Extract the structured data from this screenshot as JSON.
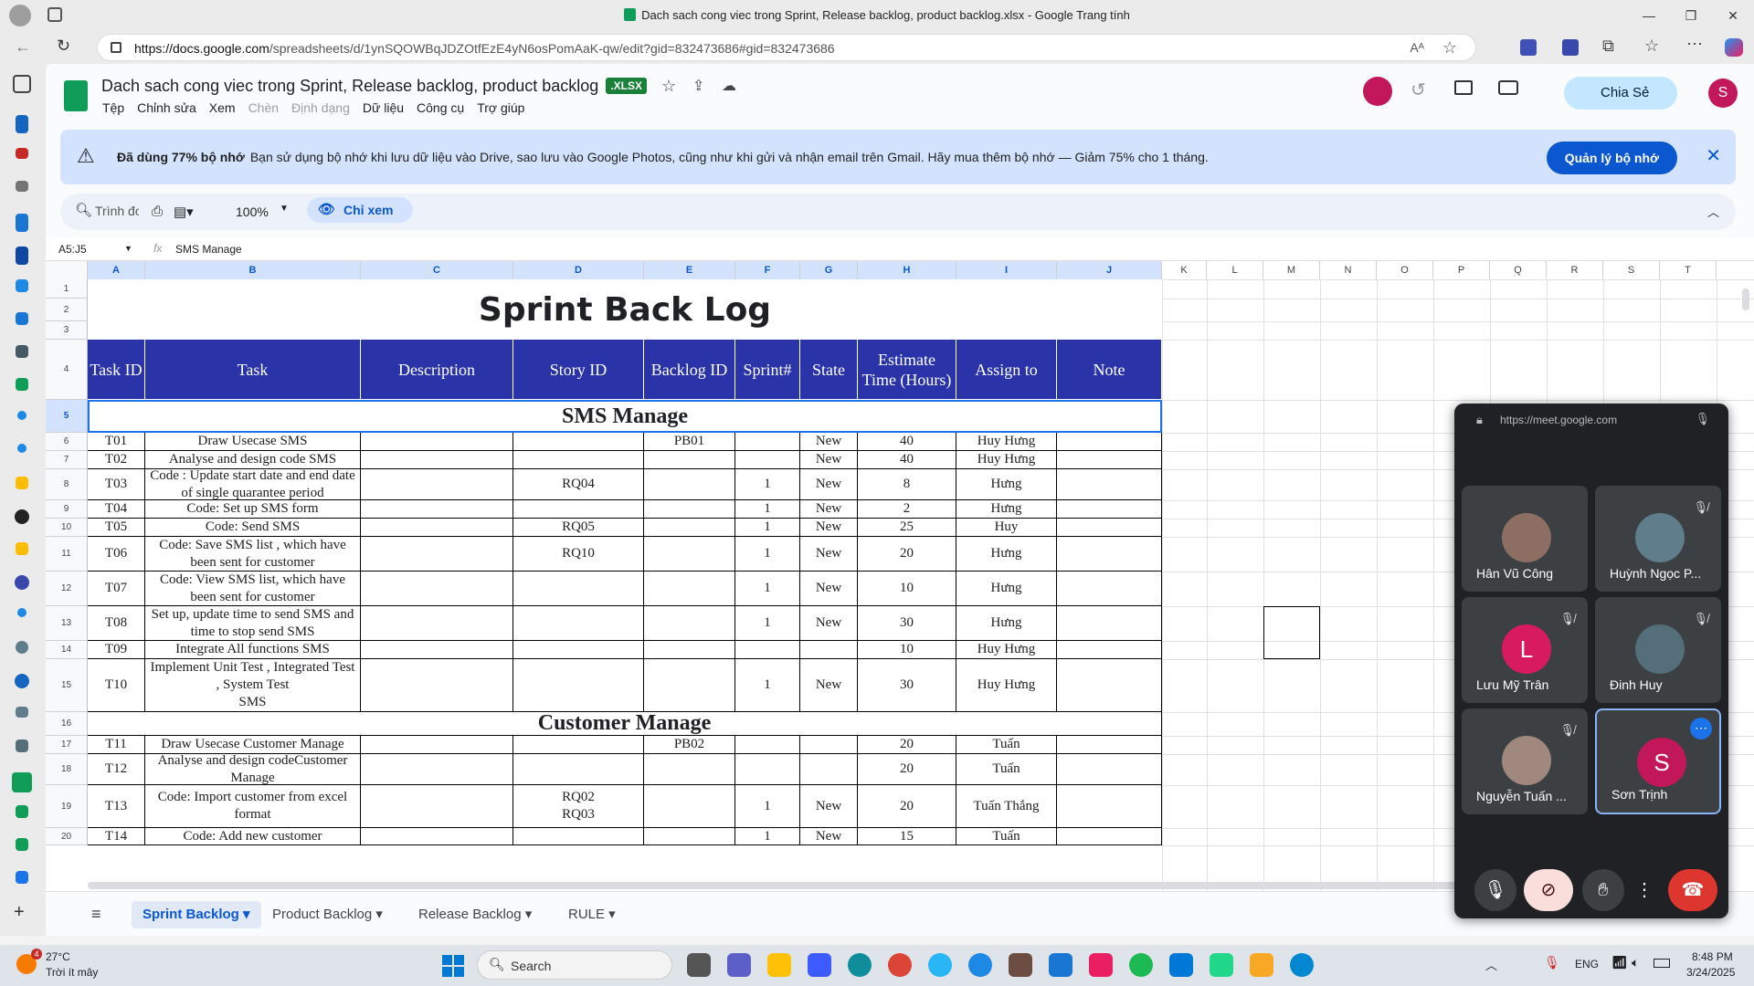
{
  "window": {
    "title": "Dach sach cong viec trong Sprint, Release backlog, product backlog.xlsx - Google Trang tính"
  },
  "browser": {
    "url_host": "https://docs.google.com",
    "url_path": "/spreadsheets/d/1ynSQOWBqJDZOtfEzE4yN6osPomAaK-qw/edit?gid=832473686#gid=832473686"
  },
  "doc": {
    "title": "Dach sach cong viec trong Sprint, Release backlog, product backlog",
    "badge": ".XLSX",
    "menus": [
      "Tệp",
      "Chỉnh sửa",
      "Xem",
      "Chèn",
      "Định dạng",
      "Dữ liệu",
      "Công cụ",
      "Trợ giúp"
    ],
    "share": "Chia Sẻ",
    "avatar": "S"
  },
  "banner": {
    "bold": "Đã dùng 77% bộ nhớ",
    "text": "Bạn sử dụng bộ nhớ khi lưu dữ liệu vào Drive, sao lưu vào Google Photos, cũng như khi gửi và nhận email trên Gmail. Hãy mua thêm bộ nhớ — Giảm 75% cho 1 tháng.",
    "button": "Quản lý bộ nhớ"
  },
  "toolbar": {
    "search": "Trình đơn",
    "zoom": "100%",
    "view_mode": "Chỉ xem"
  },
  "formula": {
    "namebox": "A5:J5",
    "content": "SMS Manage"
  },
  "columns": [
    "A",
    "B",
    "C",
    "D",
    "E",
    "F",
    "G",
    "H",
    "I",
    "J",
    "K",
    "L",
    "M",
    "N",
    "O",
    "P",
    "Q",
    "R",
    "S",
    "T"
  ],
  "sheet": {
    "title": "Sprint Back Log",
    "headers": [
      "Task ID",
      "Task",
      "Description",
      "Story ID",
      "Backlog ID",
      "Sprint#",
      "State",
      "Estimate Time (Hours)",
      "Assign to",
      "Note"
    ],
    "section1": "SMS Manage",
    "section2": "Customer Manage",
    "rows": [
      [
        "T01",
        "Draw Usecase SMS",
        "",
        "",
        "PB01",
        "",
        "New",
        "40",
        "Huy Hưng",
        ""
      ],
      [
        "T02",
        "Analyse and design code SMS",
        "",
        "",
        "",
        "",
        "New",
        "40",
        "Huy Hưng",
        ""
      ],
      [
        "T03",
        "Code : Update start date and end date of single quarantee period",
        "",
        "RQ04",
        "",
        "1",
        "New",
        "8",
        "Hưng",
        ""
      ],
      [
        "T04",
        "Code: Set up SMS form",
        "",
        "",
        "",
        "1",
        "New",
        "2",
        "Hưng",
        ""
      ],
      [
        "T05",
        "Code: Send SMS",
        "",
        "RQ05",
        "",
        "1",
        "New",
        "25",
        "Huy",
        ""
      ],
      [
        "T06",
        "Code: Save SMS list , which have been sent for customer",
        "",
        "RQ10",
        "",
        "1",
        "New",
        "20",
        "Hưng",
        ""
      ],
      [
        "T07",
        "Code: View SMS list, which have been sent for customer",
        "",
        "",
        "",
        "1",
        "New",
        "10",
        "Hưng",
        ""
      ],
      [
        "T08",
        "Set up, update time to send SMS and time to stop send SMS",
        "",
        "",
        "",
        "1",
        "New",
        "30",
        "Hưng",
        ""
      ],
      [
        "T09",
        "Integrate All functions SMS",
        "",
        "",
        "",
        "",
        "",
        "10",
        "Huy Hưng",
        ""
      ],
      [
        "T10",
        "Implement Unit Test , Integrated Test , System Test\nSMS",
        "",
        "",
        "",
        "1",
        "New",
        "30",
        "Huy Hưng",
        ""
      ],
      [
        "T11",
        "Draw Usecase Customer Manage",
        "",
        "",
        "PB02",
        "",
        "",
        "20",
        "Tuấn",
        ""
      ],
      [
        "T12",
        "Analyse and design codeCustomer Manage",
        "",
        "",
        "",
        "",
        "",
        "20",
        "Tuấn",
        ""
      ],
      [
        "T13",
        "Code: Import customer from excel format",
        "",
        "RQ02\nRQ03",
        "",
        "1",
        "New",
        "20",
        "Tuấn Thắng",
        ""
      ],
      [
        "T14",
        "Code: Add new customer",
        "",
        "",
        "",
        "1",
        "New",
        "15",
        "Tuấn",
        ""
      ]
    ]
  },
  "tabs": [
    "Sprint Backlog",
    "Product Backlog",
    "Release Backlog",
    "RULE"
  ],
  "meet": {
    "url": "https://meet.google.com",
    "participants": [
      {
        "name": "Hân Vũ Công",
        "initial": "",
        "color": "#8d6e63",
        "muted": false
      },
      {
        "name": "Huỳnh Ngọc P...",
        "initial": "",
        "color": "#607d8b",
        "muted": true
      },
      {
        "name": "Lưu Mỹ Trân",
        "initial": "L",
        "color": "#d81b60",
        "muted": true
      },
      {
        "name": "Đinh Huy",
        "initial": "",
        "color": "#546e7a",
        "muted": true
      },
      {
        "name": "Nguyễn Tuấn ...",
        "initial": "",
        "color": "#a1887f",
        "muted": true
      },
      {
        "name": "Sơn Trịnh",
        "initial": "S",
        "color": "#c2185b",
        "muted": false
      }
    ]
  },
  "taskbar": {
    "weather_temp": "27°C",
    "weather_desc": "Trời ít mây",
    "search": "Search",
    "lang": "ENG",
    "time": "8:48 PM",
    "date": "3/24/2025",
    "badge": "4"
  }
}
